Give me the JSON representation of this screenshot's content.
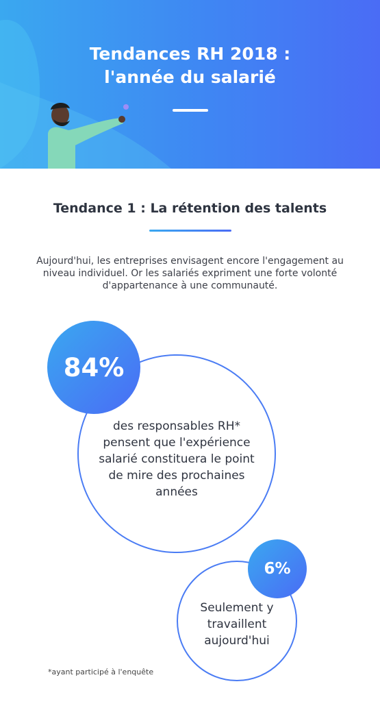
{
  "header": {
    "title_line1": "Tendances RH 2018 :",
    "title_line2": "l'année du salarié"
  },
  "section": {
    "title": "Tendance 1 : La rétention des talents",
    "intro": "Aujourd'hui, les entreprises envisagent encore l'engagement au niveau individuel. Or les salariés expriment une forte volonté d'appartenance à une communauté."
  },
  "stats": [
    {
      "value": "84%",
      "text": "des responsables RH* pensent que l'expérience salarié constituera le point de mire des prochaines années"
    },
    {
      "value": "6%",
      "text": "Seulement y travaillent aujourd'hui"
    }
  ],
  "footnote": "*ayant participé à l'enquête",
  "colors": {
    "gradient_start": "#3aa8f0",
    "gradient_end": "#4a6cf5",
    "accent_ring": "#4a7cf4"
  }
}
